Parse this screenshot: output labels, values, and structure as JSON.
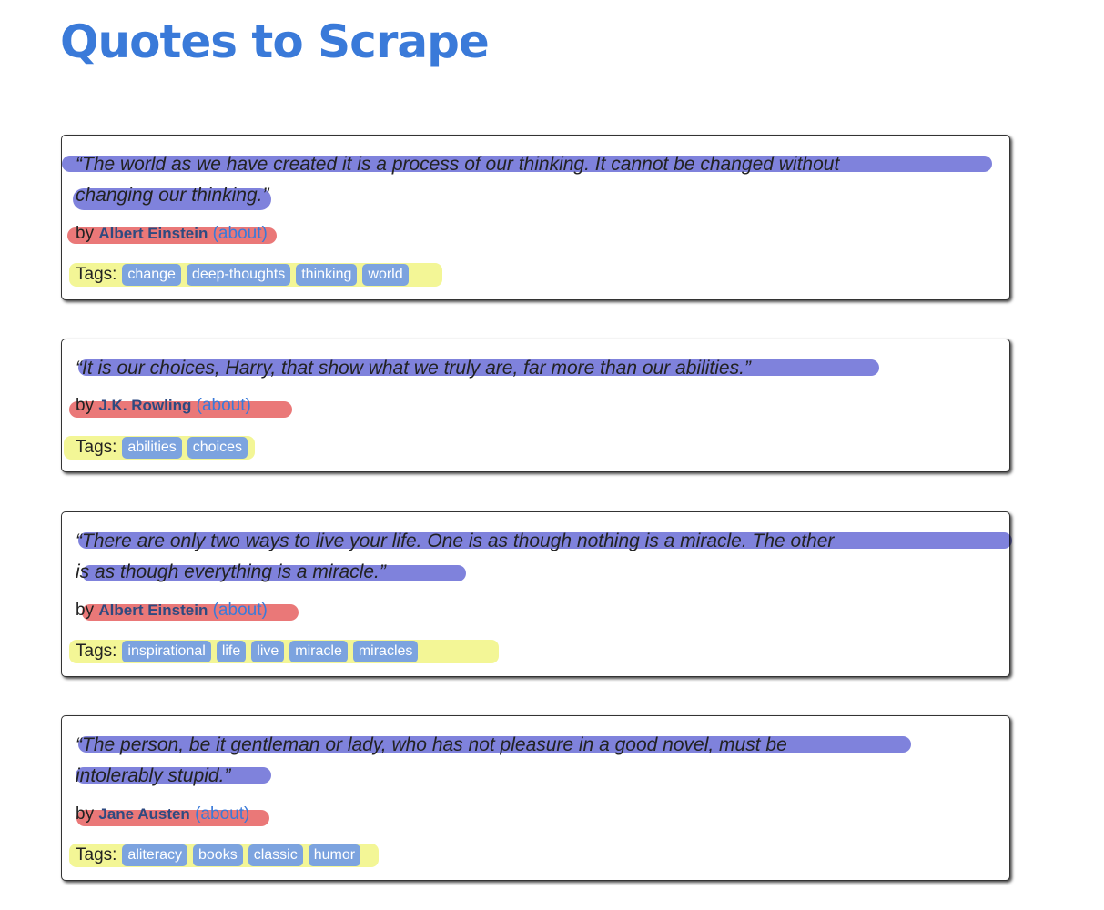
{
  "site": {
    "title": "Quotes to Scrape"
  },
  "quotes": [
    {
      "text_line1": "“The world as we have created it is a process of our thinking. It cannot be changed without",
      "text_line2": "changing our thinking.”",
      "by": "by",
      "author": "Albert Einstein",
      "about": "(about)",
      "tags_label": "Tags:",
      "tags": [
        "change",
        "deep-thoughts",
        "thinking",
        "world"
      ]
    },
    {
      "text_line1": "“It is our choices, Harry, that show what we truly are, far more than our abilities.”",
      "by": "by",
      "author": "J.K. Rowling",
      "about": "(about)",
      "tags_label": "Tags:",
      "tags": [
        "abilities",
        "choices"
      ]
    },
    {
      "text_line1": "“There are only two ways to live your life. One is as though nothing is a miracle. The other",
      "text_line2": "is as though everything is a miracle.”",
      "by": "by",
      "author": "Albert Einstein",
      "about": "(about)",
      "tags_label": "Tags:",
      "tags": [
        "inspirational",
        "life",
        "live",
        "miracle",
        "miracles"
      ]
    },
    {
      "text_line1": "“The person, be it gentleman or lady, who has not pleasure in a good novel, must be",
      "text_line2": "intolerably stupid.”",
      "by": "by",
      "author": "Jane Austen",
      "about": "(about)",
      "tags_label": "Tags:",
      "tags": [
        "aliteracy",
        "books",
        "classic",
        "humor"
      ]
    }
  ],
  "colors": {
    "title": "#3a7ad9",
    "tag_bg": "#7ca3df",
    "highlight_quote": "#686cd6",
    "highlight_author": "#e66060",
    "highlight_tags": "#f5f53c"
  }
}
